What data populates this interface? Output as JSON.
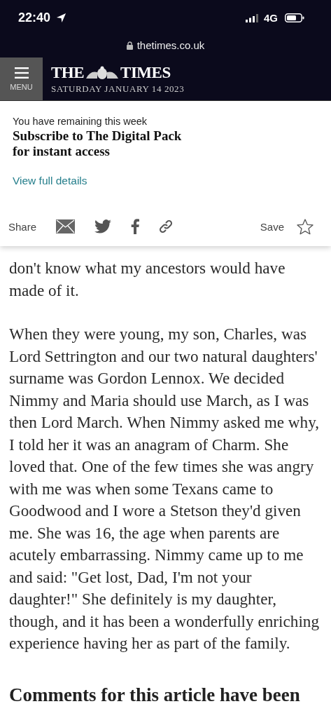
{
  "status_bar": {
    "time": "22:40",
    "network": "4G"
  },
  "address_bar": {
    "url": "thetimes.co.uk"
  },
  "masthead": {
    "menu_label": "MENU",
    "title_left": "THE",
    "title_right": "TIMES",
    "date": "SATURDAY JANUARY 14 2023"
  },
  "promo": {
    "intro": "You have remaining this week",
    "headline": "Subscribe to The Digital Pack for instant access",
    "link": "View full details"
  },
  "share_bar": {
    "share_label": "Share",
    "save_label": "Save"
  },
  "article": {
    "paragraphs": [
      "don't know what my ancestors would have made of it.",
      "When they were young, my son, Charles, was Lord Settrington and our two natural daughters' surname was Gordon Lennox. We decided Nimmy and Maria should use March, as I was then Lord March. When Nimmy asked me why, I told her it was an anagram of Charm. She loved that. One of the few times she was angry with me was when some Texans came to Goodwood and I wore a Stetson they'd given me. She was 16, the age when parents are acutely embarrassing. Nimmy came up to me and said: \"Get lost, Dad, I'm not your daughter!\" She definitely is my daughter, though, and it has been a wonderfully enriching experience having her as part of the family."
    ]
  },
  "comments_heading": "Comments for this article have been"
}
